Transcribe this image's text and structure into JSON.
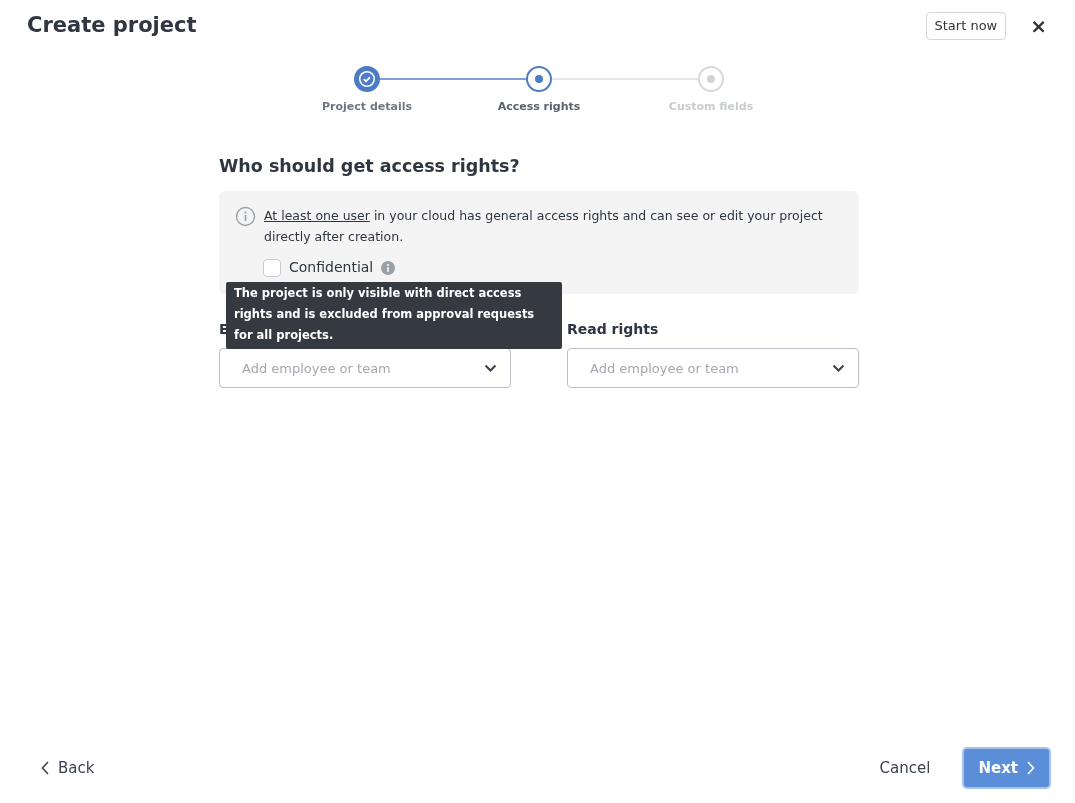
{
  "header": {
    "title": "Create project",
    "start_button": "Start now",
    "close": "×"
  },
  "steps": [
    {
      "label": "Project details",
      "done": true,
      "selected": false
    },
    {
      "label": "Access rights",
      "done": false,
      "selected": true
    },
    {
      "label": "Custom fields",
      "done": false,
      "selected": false
    }
  ],
  "heading": "Who should get access rights?",
  "notice": {
    "link": "At least one user",
    "text": " in your cloud has general access rights and can see or edit your project directly after creation.",
    "checkbox": {
      "label": "Confidential",
      "checked": false
    }
  },
  "tooltip": "The project is only visible with direct access rights and is excluded from approval requests for all projects.",
  "fields": [
    {
      "label": "E",
      "placeholder": "Add employee or team"
    },
    {
      "label": "Read rights",
      "placeholder": "Add employee or team"
    }
  ],
  "footer": {
    "back": "Back",
    "cancel": "Cancel",
    "next": "Next"
  }
}
